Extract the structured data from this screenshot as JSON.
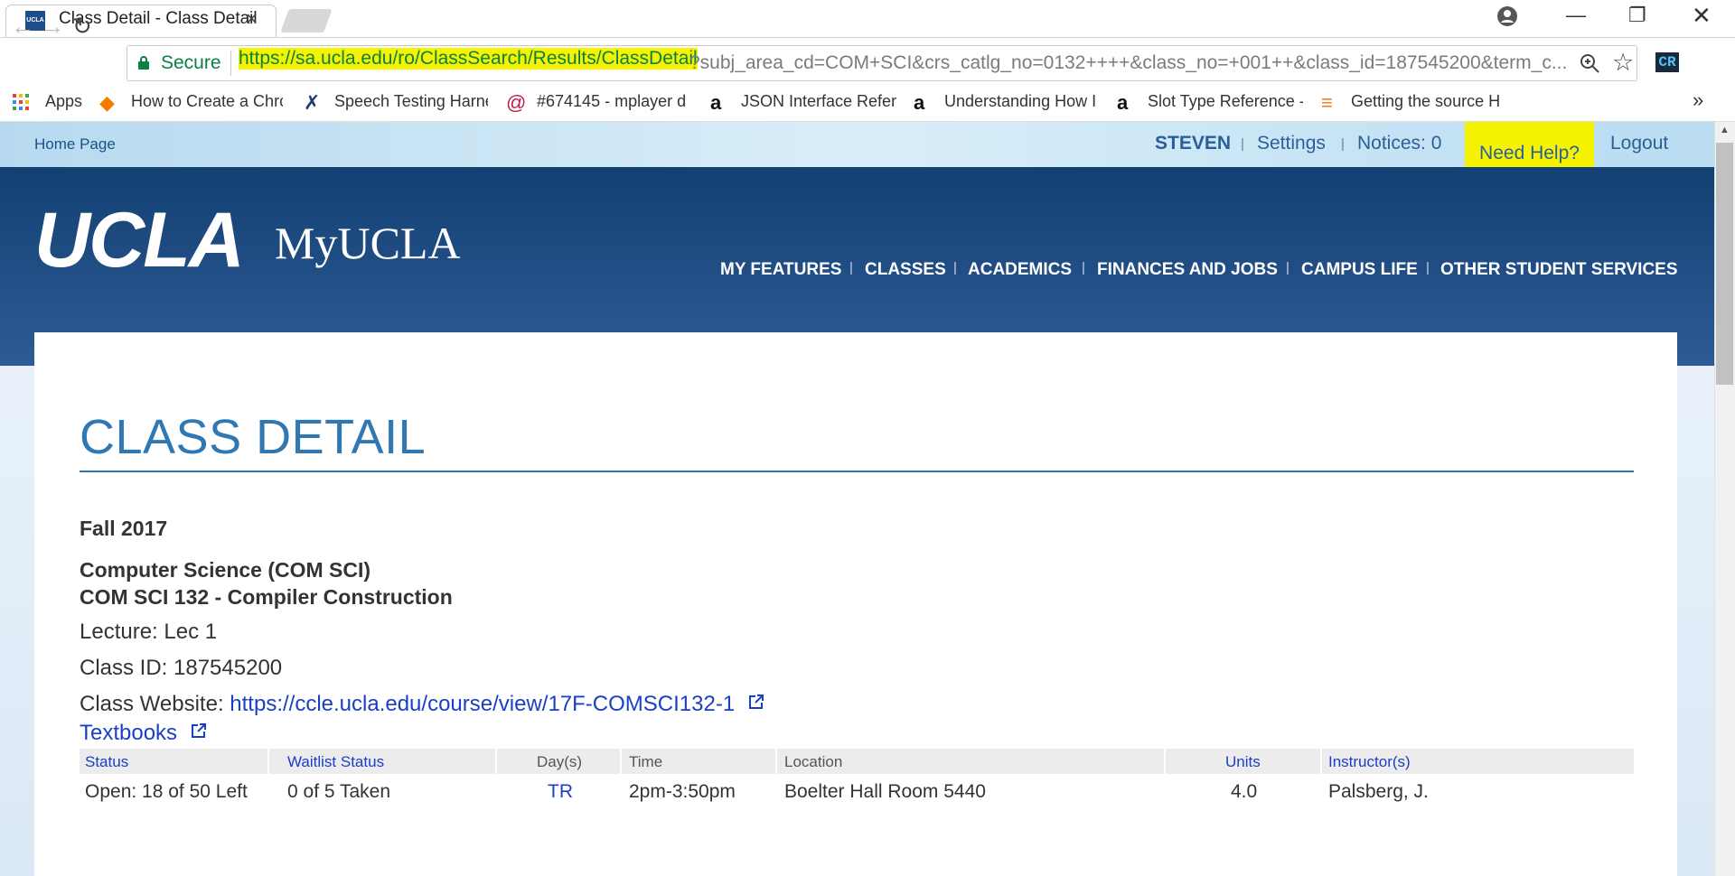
{
  "browser": {
    "tab_title": "Class Detail - Class Detail",
    "tab_favicon_text": "UCLA",
    "secure_label": "Secure",
    "url_highlight": "https://sa.ucla.edu/ro/ClassSearch/Results/ClassDetail",
    "url_rest": "?subj_area_cd=COM+SCI&crs_catlg_no=0132++++&class_no=+001++&class_id=187545200&term_c...",
    "extension_label": "CR",
    "highlight_color": "#f6f300"
  },
  "bookmarks": [
    {
      "label": "Apps",
      "icon": "apps-grid-icon"
    },
    {
      "label": "How to Create a Chrc",
      "icon": "diamond-icon"
    },
    {
      "label": "Speech Testing Harne",
      "icon": "x-logo-icon"
    },
    {
      "label": "#674145 - mplayer d",
      "icon": "swirl-icon"
    },
    {
      "label": "JSON Interface Refere",
      "icon": "amazon-icon"
    },
    {
      "label": "Understanding How I",
      "icon": "amazon-icon"
    },
    {
      "label": "Slot Type Reference -",
      "icon": "amazon-icon"
    },
    {
      "label": "Getting the source H",
      "icon": "stack-icon"
    }
  ],
  "header": {
    "home_link": "Home Page",
    "user": "STEVEN",
    "settings": "Settings",
    "notices": "Notices: 0",
    "need_help": "Need Help?",
    "logout": "Logout",
    "logo": "UCLA",
    "site_name": "MyUCLA",
    "nav": [
      "MY FEATURES",
      "CLASSES",
      "ACADEMICS",
      "FINANCES AND JOBS",
      "CAMPUS LIFE",
      "OTHER STUDENT SERVICES"
    ]
  },
  "main": {
    "heading": "CLASS DETAIL",
    "term": "Fall 2017",
    "subject": "Computer Science (COM SCI)",
    "course": "COM SCI 132 - Compiler Construction",
    "lecture": "Lecture: Lec 1",
    "class_id": "Class ID: 187545200",
    "website_label": "Class Website:",
    "website_url": "https://ccle.ucla.edu/course/view/17F-COMSCI132-1",
    "textbooks": "Textbooks"
  },
  "table": {
    "headers": [
      "Status",
      "Waitlist Status",
      "Day(s)",
      "Time",
      "Location",
      "Units",
      "Instructor(s)"
    ],
    "row": [
      "Open: 18 of 50 Left",
      "0 of 5 Taken",
      "TR",
      "2pm-3:50pm",
      "Boelter Hall Room 5440",
      "4.0",
      "Palsberg, J."
    ]
  }
}
